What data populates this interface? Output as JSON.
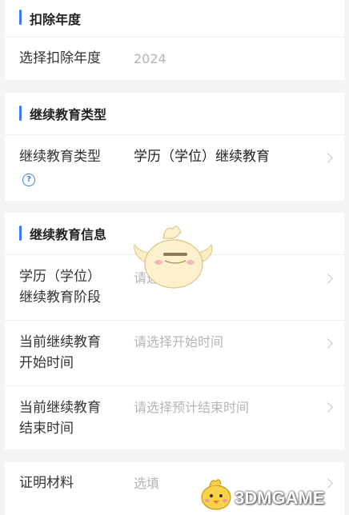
{
  "section1": {
    "title": "扣除年度",
    "year_label": "选择扣除年度",
    "year_value": "2024"
  },
  "section2": {
    "title": "继续教育类型",
    "type_label": "继续教育类型",
    "type_value": "学历（学位）继续教育",
    "help_icon": "help-circle-icon"
  },
  "section3": {
    "title": "继续教育信息",
    "stage_label_line1": "学历（学位）",
    "stage_label_line2": "继续教育阶段",
    "stage_placeholder": "请选择",
    "start_label_line1": "当前继续教育",
    "start_label_line2": "开始时间",
    "start_placeholder": "请选择开始时间",
    "end_label_line1": "当前继续教育",
    "end_label_line2": "结束时间",
    "end_placeholder": "请选择预计结束时间"
  },
  "section4": {
    "proof_label": "证明材料",
    "proof_placeholder": "选填"
  },
  "watermark": {
    "text": "3DMGAME",
    "mascot_icon": "chick-mascot-icon"
  },
  "colors": {
    "accent": "#3b7cf5",
    "background": "#f3f4f6",
    "placeholder": "#b5b5b5"
  }
}
